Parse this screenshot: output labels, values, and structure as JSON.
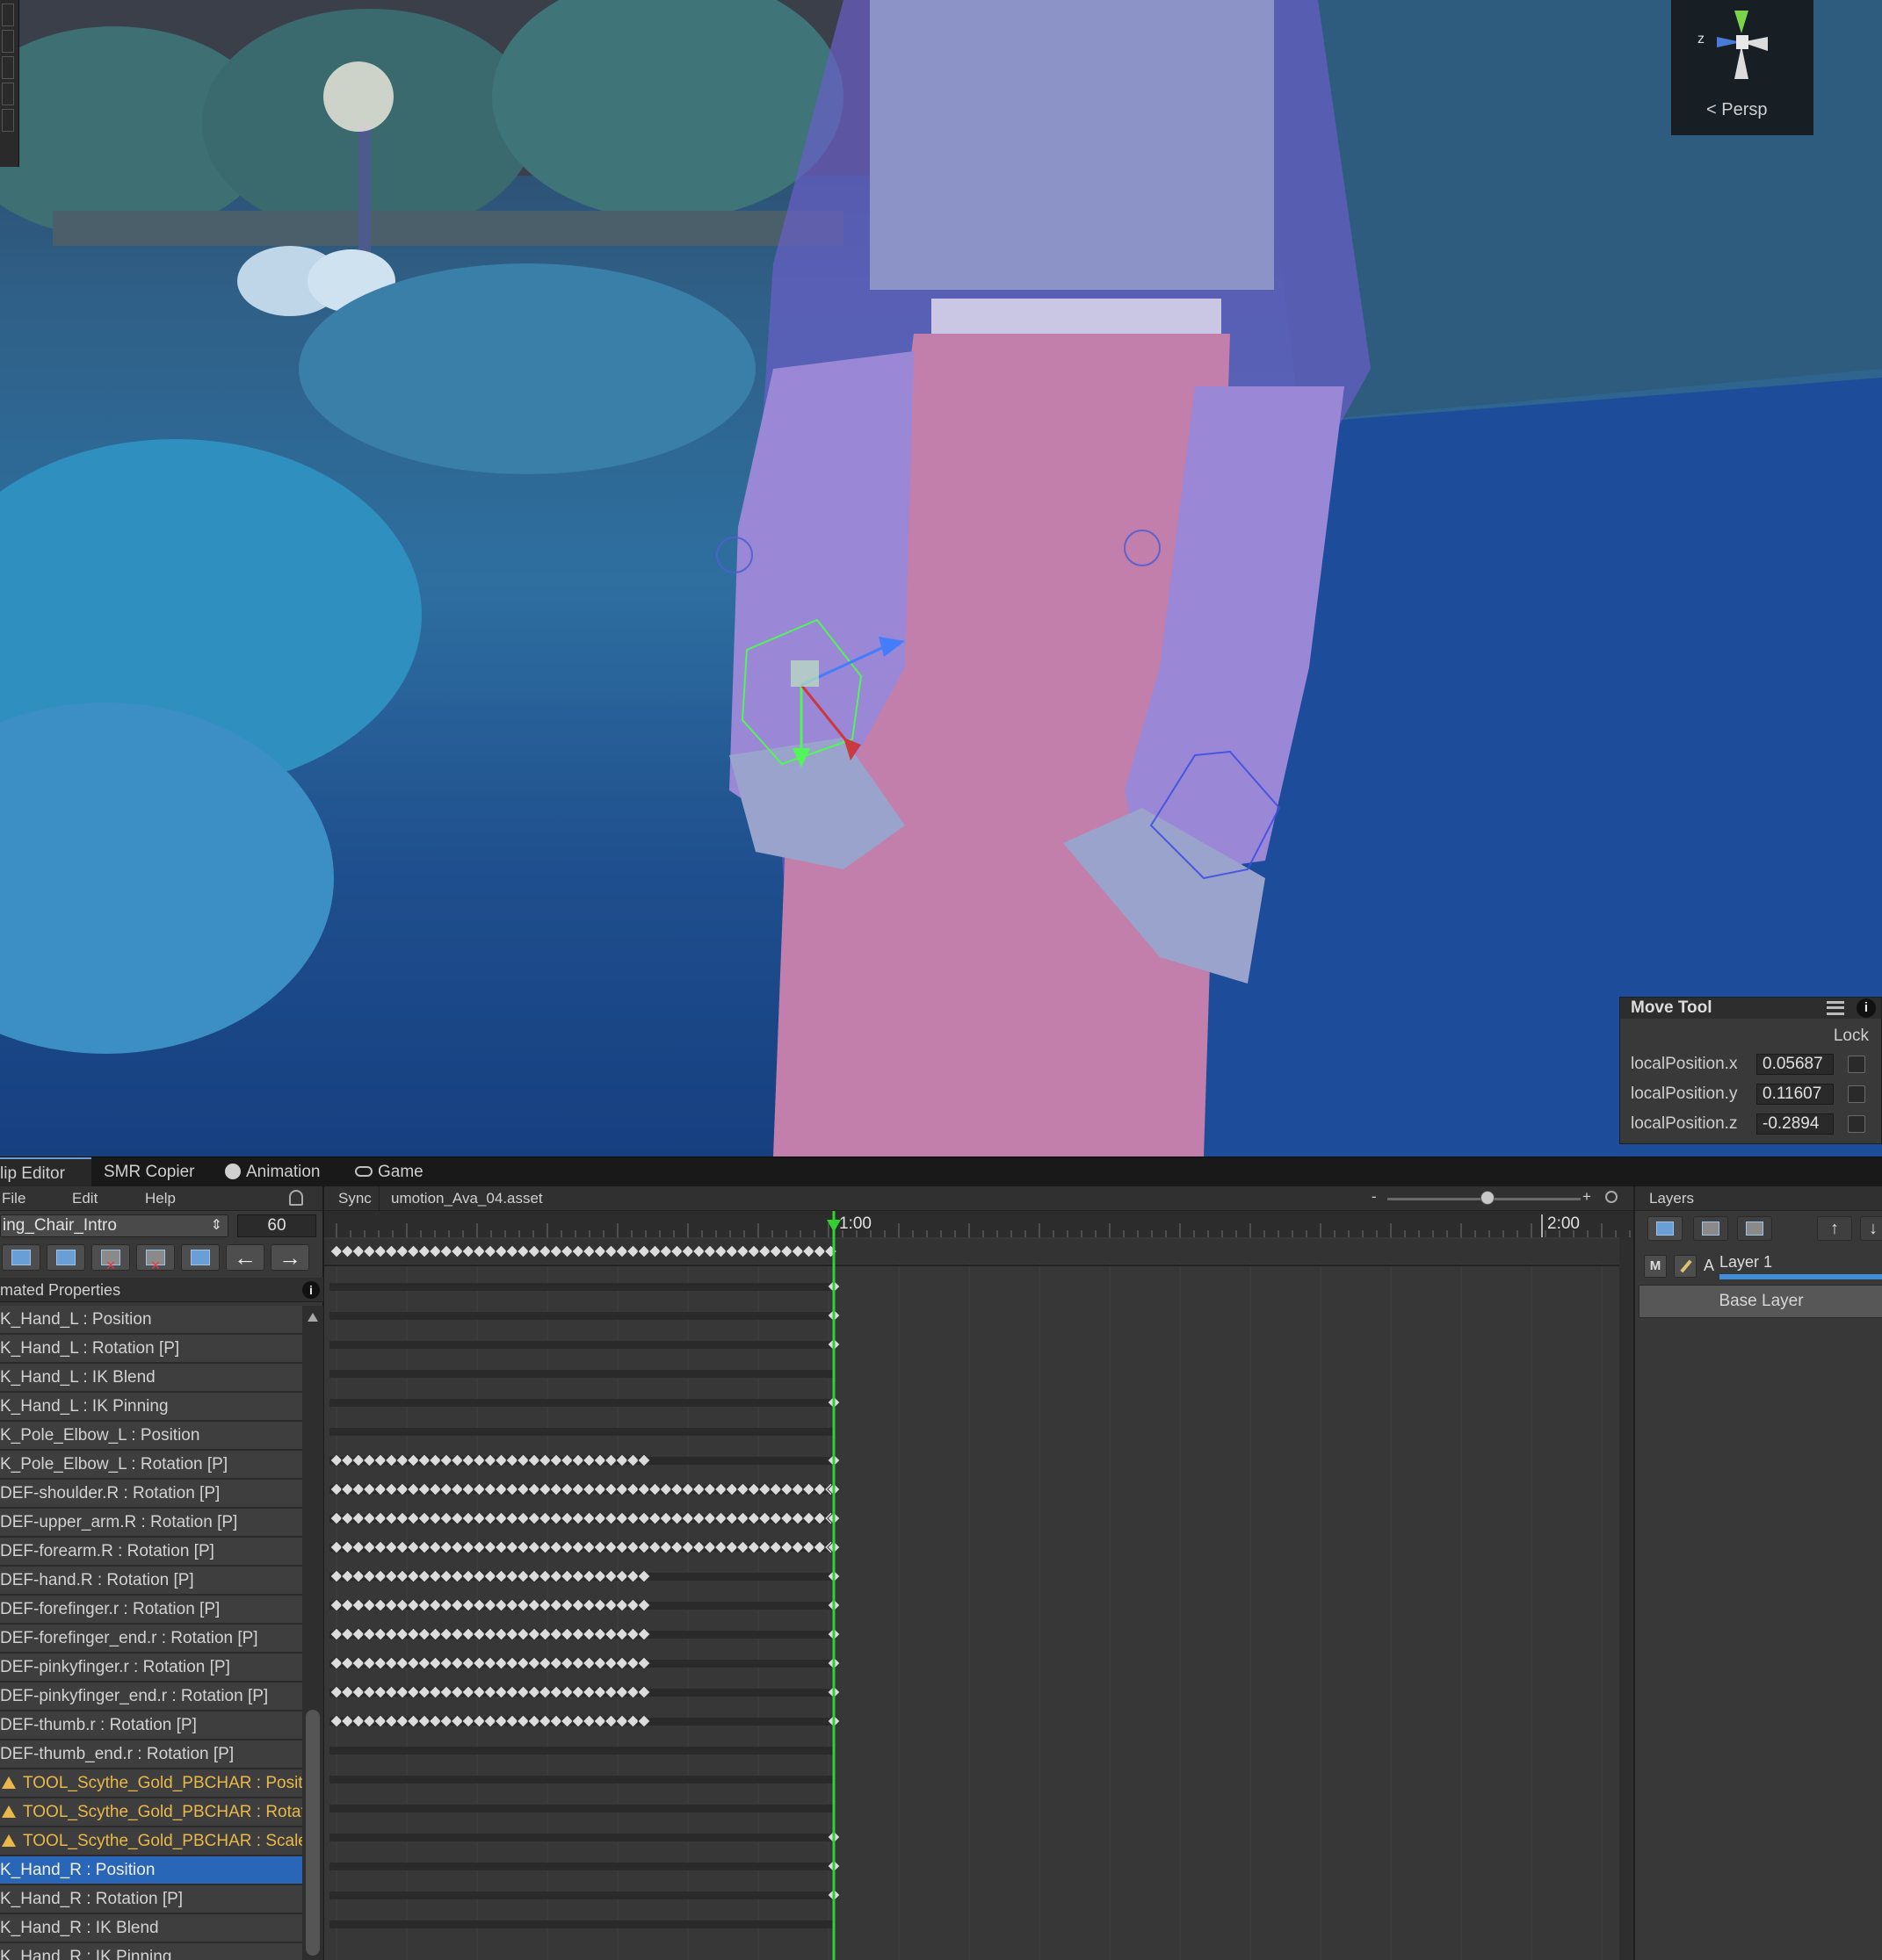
{
  "scene": {
    "gizmo": {
      "view_label": "Persp",
      "axis_label": "z"
    },
    "move_tool": {
      "title": "Move Tool",
      "lock_label": "Lock",
      "fields": [
        {
          "label": "localPosition.x",
          "value": "0.05687"
        },
        {
          "label": "localPosition.y",
          "value": "0.11607"
        },
        {
          "label": "localPosition.z",
          "value": "-0.2894"
        }
      ]
    }
  },
  "tabs": [
    {
      "label": "lip Editor"
    },
    {
      "label": "SMR Copier"
    },
    {
      "label": "Animation",
      "icon": "animation-icon"
    },
    {
      "label": "Game",
      "icon": "gamepad-icon"
    }
  ],
  "clip_editor": {
    "menu": {
      "file": "File",
      "edit": "Edit",
      "help": "Help"
    },
    "clip_name": "ing_Chair_Intro",
    "fps": "60",
    "properties_header": "mated Properties",
    "properties": [
      {
        "label": "K_Hand_L : Position"
      },
      {
        "label": "K_Hand_L : Rotation [P]"
      },
      {
        "label": "K_Hand_L : IK Blend"
      },
      {
        "label": "K_Hand_L : IK Pinning"
      },
      {
        "label": "K_Pole_Elbow_L : Position"
      },
      {
        "label": "K_Pole_Elbow_L : Rotation [P]"
      },
      {
        "label": "DEF-shoulder.R : Rotation [P]"
      },
      {
        "label": "DEF-upper_arm.R : Rotation [P]"
      },
      {
        "label": "DEF-forearm.R : Rotation [P]"
      },
      {
        "label": "DEF-hand.R : Rotation [P]"
      },
      {
        "label": "DEF-forefinger.r : Rotation [P]"
      },
      {
        "label": "DEF-forefinger_end.r : Rotation [P]"
      },
      {
        "label": "DEF-pinkyfinger.r : Rotation [P]"
      },
      {
        "label": "DEF-pinkyfinger_end.r : Rotation [P]"
      },
      {
        "label": "DEF-thumb.r : Rotation [P]"
      },
      {
        "label": "DEF-thumb_end.r : Rotation [P]"
      },
      {
        "label": "TOOL_Scythe_Gold_PBCHAR : Positi",
        "warning": true
      },
      {
        "label": "TOOL_Scythe_Gold_PBCHAR : Rotati",
        "warning": true
      },
      {
        "label": "TOOL_Scythe_Gold_PBCHAR : Scale",
        "warning": true
      },
      {
        "label": "K_Hand_R : Position",
        "selected": true
      },
      {
        "label": "K_Hand_R : Rotation [P]"
      },
      {
        "label": "K_Hand_R : IK Blend"
      },
      {
        "label": "K_Hand_R : IK Pinning"
      }
    ]
  },
  "timeline": {
    "sync_label": "Sync",
    "asset_name": "umotion_Ava_04.asset",
    "zoom_minus": "-",
    "zoom_plus": "+",
    "zoom_level": 0.52,
    "ruler_labels": [
      "1:00",
      "2:00"
    ],
    "playhead_color": "#2fd22f",
    "keyframe_color": "#dcdcdc",
    "rows": [
      {
        "dense_until": 0,
        "end_key": true
      },
      {
        "dense_until": 0,
        "end_key": true
      },
      {
        "dense_until": 0,
        "end_key": true
      },
      {
        "dense_until": 0,
        "end_key": false
      },
      {
        "dense_until": 0,
        "end_key": true
      },
      {
        "dense_until": 0,
        "end_key": false
      },
      {
        "dense_until": 0.62,
        "end_key": true
      },
      {
        "dense_until": 1.0,
        "end_key": true
      },
      {
        "dense_until": 1.0,
        "end_key": true
      },
      {
        "dense_until": 1.0,
        "end_key": true
      },
      {
        "dense_until": 0.64,
        "end_key": true
      },
      {
        "dense_until": 0.64,
        "end_key": true
      },
      {
        "dense_until": 0.64,
        "end_key": true
      },
      {
        "dense_until": 0.64,
        "end_key": true
      },
      {
        "dense_until": 0.64,
        "end_key": true
      },
      {
        "dense_until": 0.64,
        "end_key": true
      },
      {
        "dense_until": 0,
        "end_key": false
      },
      {
        "dense_until": 0,
        "end_key": false
      },
      {
        "dense_until": 0,
        "end_key": false
      },
      {
        "dense_until": 0,
        "end_key": true
      },
      {
        "dense_until": 0,
        "end_key": true
      },
      {
        "dense_until": 0,
        "end_key": true
      },
      {
        "dense_until": 0,
        "end_key": false
      }
    ]
  },
  "layers": {
    "title": "Layers",
    "layer_mute": "M",
    "layer_additive": "A",
    "layer_name": "Layer 1",
    "base_layer": "Base Layer"
  },
  "colors": {
    "accent": "#2a66b8",
    "warning": "#e9b84a",
    "playhead": "#2fd22f"
  }
}
